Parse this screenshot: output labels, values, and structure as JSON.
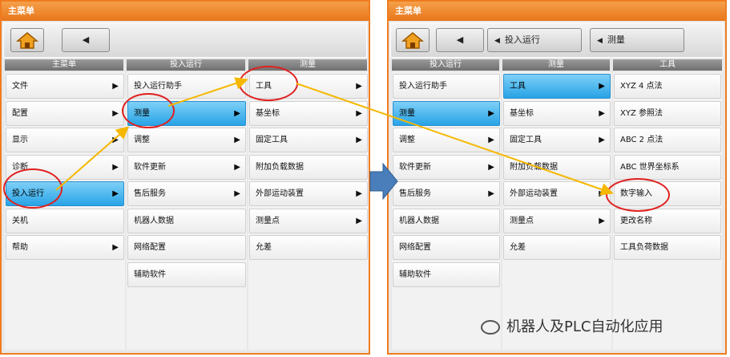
{
  "left": {
    "title": "主菜单",
    "back_glyph": "◀",
    "columns": [
      {
        "header": "主菜单",
        "items": [
          {
            "label": "文件",
            "arrow": true
          },
          {
            "label": "配置",
            "arrow": true
          },
          {
            "label": "显示",
            "arrow": true
          },
          {
            "label": "诊断",
            "arrow": true
          },
          {
            "label": "投入运行",
            "arrow": true,
            "selected": true
          },
          {
            "label": "关机",
            "arrow": false
          },
          {
            "label": "帮助",
            "arrow": true
          }
        ]
      },
      {
        "header": "投入运行",
        "items": [
          {
            "label": "投入运行助手",
            "arrow": false
          },
          {
            "label": "测量",
            "arrow": true,
            "selected": true
          },
          {
            "label": "调整",
            "arrow": true
          },
          {
            "label": "软件更新",
            "arrow": true
          },
          {
            "label": "售后服务",
            "arrow": true
          },
          {
            "label": "机器人数据",
            "arrow": false
          },
          {
            "label": "网络配置",
            "arrow": false
          },
          {
            "label": "辅助软件",
            "arrow": false
          }
        ]
      },
      {
        "header": "测量",
        "items": [
          {
            "label": "工具",
            "arrow": true
          },
          {
            "label": "基坐标",
            "arrow": true
          },
          {
            "label": "固定工具",
            "arrow": true
          },
          {
            "label": "附加负载数据",
            "arrow": false
          },
          {
            "label": "外部运动装置",
            "arrow": true
          },
          {
            "label": "测量点",
            "arrow": true
          },
          {
            "label": "允差",
            "arrow": false
          }
        ]
      }
    ]
  },
  "right": {
    "title": "主菜单",
    "back_glyph": "◀",
    "crumbs": [
      "投入运行",
      "测量"
    ],
    "columns": [
      {
        "header": "投入运行",
        "items": [
          {
            "label": "投入运行助手",
            "arrow": false
          },
          {
            "label": "测量",
            "arrow": true,
            "selected": true
          },
          {
            "label": "调整",
            "arrow": true
          },
          {
            "label": "软件更新",
            "arrow": true
          },
          {
            "label": "售后服务",
            "arrow": true
          },
          {
            "label": "机器人数据",
            "arrow": false
          },
          {
            "label": "网络配置",
            "arrow": false
          },
          {
            "label": "辅助软件",
            "arrow": false
          }
        ]
      },
      {
        "header": "测量",
        "items": [
          {
            "label": "工具",
            "arrow": true,
            "selected": true
          },
          {
            "label": "基坐标",
            "arrow": true
          },
          {
            "label": "固定工具",
            "arrow": true
          },
          {
            "label": "附加负载数据",
            "arrow": false
          },
          {
            "label": "外部运动装置",
            "arrow": true
          },
          {
            "label": "测量点",
            "arrow": true
          },
          {
            "label": "允差",
            "arrow": false
          }
        ]
      },
      {
        "header": "工具",
        "items": [
          {
            "label": "XYZ 4 点法",
            "arrow": false
          },
          {
            "label": "XYZ 参照法",
            "arrow": false
          },
          {
            "label": "ABC 2 点法",
            "arrow": false
          },
          {
            "label": "ABC 世界坐标系",
            "arrow": false
          },
          {
            "label": "数字输入",
            "arrow": false
          },
          {
            "label": "更改名称",
            "arrow": false
          },
          {
            "label": "工具负荷数据",
            "arrow": false
          }
        ]
      }
    ]
  },
  "watermark": "机器人及PLC自动化应用",
  "colors": {
    "frame": "#f07b1e",
    "selected": "#27a3e6",
    "circle": "#e02020",
    "path_arrow": "#f5b800",
    "flow_arrow": "#4a7ebb"
  }
}
